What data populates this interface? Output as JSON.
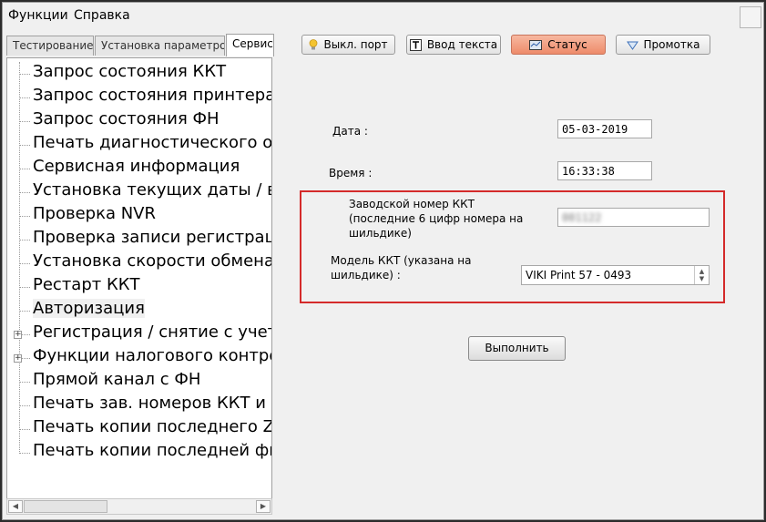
{
  "menu": {
    "functions": "Функции",
    "help": "Справка"
  },
  "tabs": [
    {
      "label": "Тестирование"
    },
    {
      "label": "Установка параметров"
    },
    {
      "label": "Сервис"
    }
  ],
  "toolbar": {
    "port_off": "Выкл. порт",
    "text_input": "Ввод текста",
    "status": "Статус",
    "feed": "Промотка"
  },
  "tree": [
    "Запрос состояния ККТ",
    "Запрос состояния принтера",
    "Запрос состояния ФН",
    "Печать диагностического отч",
    "Сервисная информация",
    "Установка текущих даты / вр",
    "Проверка NVR",
    "Проверка записи регистраци",
    "Установка скорости обмена",
    "Рестарт ККТ",
    "Авторизация",
    "Регистрация / снятие с учета",
    "Функции налогового контрол",
    "Прямой канал с ФН",
    "Печать зав. номеров ККТ и Ф",
    "Печать копии последнего Z-о",
    "Печать копии последней фис"
  ],
  "form": {
    "date_label": "Дата :",
    "date_value": "05-03-2019",
    "time_label": "Время :",
    "time_value": "16:33:38",
    "serial_label_1": "Заводской номер ККТ",
    "serial_label_2": "(последние 6 цифр номера на",
    "serial_label_3": "шильдике)",
    "serial_value": "001122",
    "model_label_1": "Модель ККТ (указана на",
    "model_label_2": "шильдике)  :",
    "model_value": "VIKI Print 57  - 0493",
    "execute": "Выполнить"
  }
}
